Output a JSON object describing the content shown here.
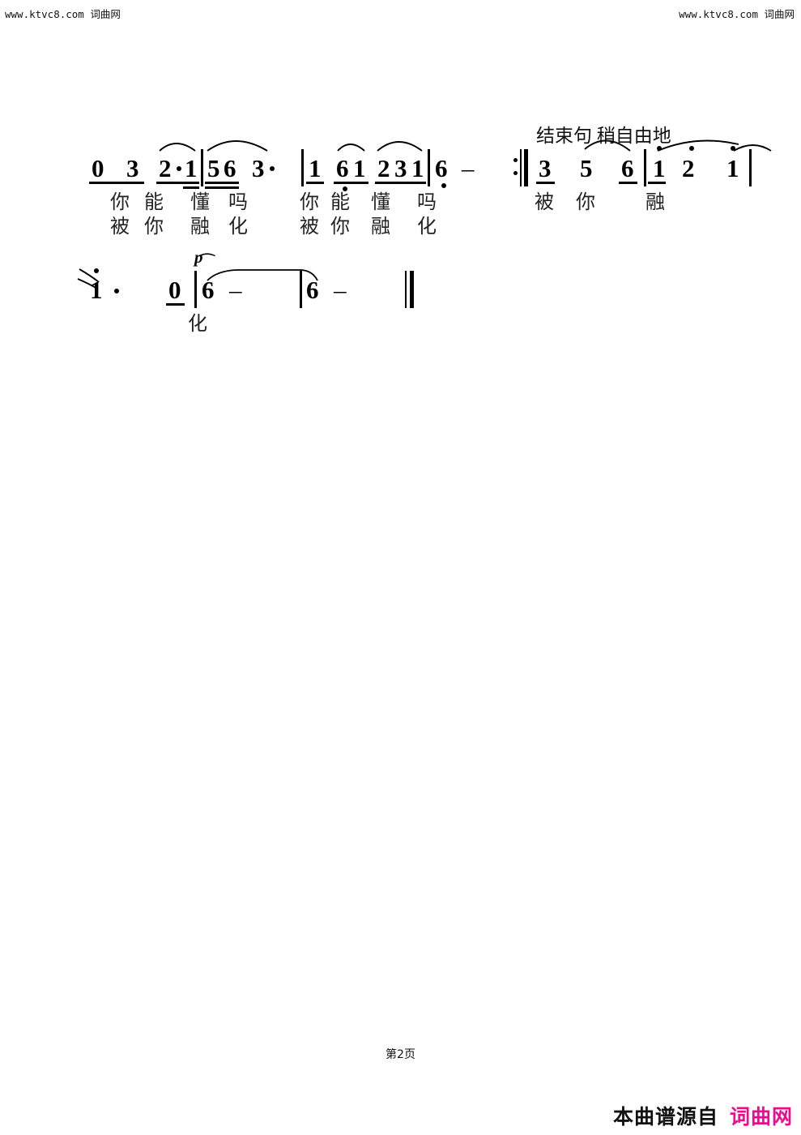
{
  "watermark": {
    "top_left": "www.ktvc8.com 词曲网",
    "top_right": "www.ktvc8.com 词曲网"
  },
  "footer": {
    "page_label": "第2页",
    "source_prefix": "本曲谱源自",
    "source_brand": "词曲网",
    "brand_color": "#ee0a8c"
  },
  "score": {
    "expression_marks": [
      {
        "id": "ending_phrase",
        "text": "结束句  稍自由地"
      }
    ],
    "dynamics": [
      {
        "id": "piano",
        "text": "p"
      }
    ],
    "system1": {
      "measures": [
        {
          "id": "m1",
          "notes": [
            "0",
            "3",
            "2",
            "·",
            "1"
          ],
          "beams": "0 3 single; 2·1 with 1 double"
        },
        {
          "id": "m2",
          "notes": [
            "5",
            "6",
            "3",
            "·"
          ],
          "beams": "56 double beam; 3 dotted"
        },
        {
          "id": "m3",
          "notes": [
            "1",
            "6",
            "1"
          ],
          "beams": "1 single; 61 single with low octave dot on 6"
        },
        {
          "id": "m4",
          "notes": [
            "2",
            "3",
            "1"
          ],
          "beams": "231 single beam"
        },
        {
          "id": "m5",
          "notes": [
            "6",
            "–"
          ],
          "beams": "low octave dot on 6"
        },
        {
          "id": "m6",
          "notes": [
            "3",
            "5",
            "6"
          ],
          "beams": "3 single beam"
        },
        {
          "id": "m7",
          "notes": [
            "1",
            "2",
            "1"
          ],
          "beams": "high octave dots"
        }
      ],
      "lyrics_row1": [
        "你",
        "能",
        "懂",
        "吗",
        "你",
        "能",
        "懂",
        "吗",
        "被",
        "你",
        "融"
      ],
      "lyrics_row2": [
        "被",
        "你",
        "融",
        "化",
        "被",
        "你",
        "融",
        "化"
      ]
    },
    "system2": {
      "measures": [
        {
          "id": "m8",
          "notes": [
            "1",
            "·"
          ],
          "beams": "tied high do dotted"
        },
        {
          "id": "m9",
          "notes": [
            "0"
          ],
          "beams": "single beam rest"
        },
        {
          "id": "m10",
          "notes": [
            "6",
            "–"
          ],
          "beams": "fermata, tie begins"
        },
        {
          "id": "m11",
          "notes": [
            "6",
            "–"
          ],
          "beams": "tie ends"
        }
      ],
      "lyrics_row1": [
        "化"
      ],
      "final_barline": "thin-thick"
    },
    "repeat_sign": ":||"
  }
}
